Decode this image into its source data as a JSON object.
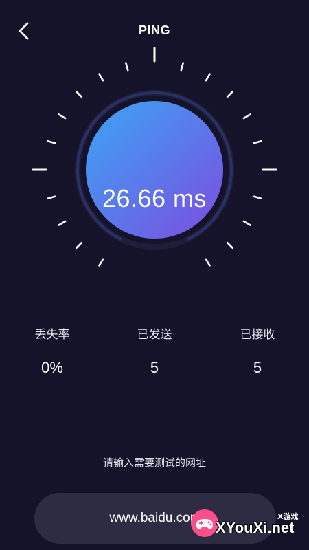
{
  "header": {
    "title": "PING",
    "back_icon": "chevron-left-icon"
  },
  "gauge": {
    "ping_text": "26.66 ms",
    "gradient_start": "#3aa6f5",
    "gradient_end": "#7d4ce0",
    "tick_color": "#ffffff",
    "track_color": "#262a52"
  },
  "stats": [
    {
      "label": "丢失率",
      "value": "0%"
    },
    {
      "label": "已发送",
      "value": "5"
    },
    {
      "label": "已接收",
      "value": "5"
    }
  ],
  "url": {
    "prompt": "请输入需要测试的网址",
    "value": "www.baidu.com"
  },
  "watermark": {
    "tag": "X游戏",
    "text": "XYouXi.net"
  }
}
